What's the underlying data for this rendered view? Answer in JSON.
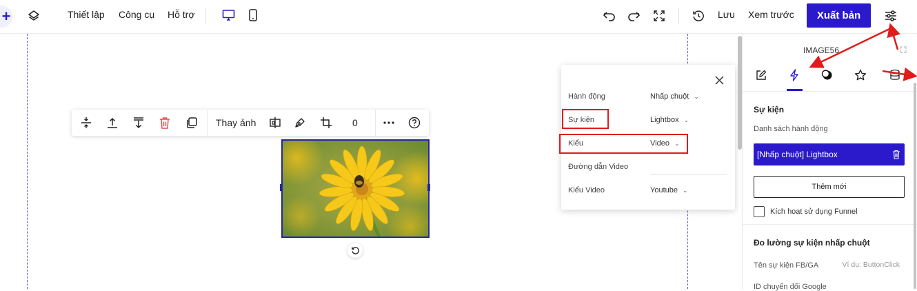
{
  "topbar": {
    "menu": [
      "Thiết lập",
      "Công cụ",
      "Hỗ trợ"
    ],
    "save_label": "Lưu",
    "preview_label": "Xem trước",
    "publish_label": "Xuất bản",
    "accent": "#2a1acb"
  },
  "toolbar": {
    "replace_image_label": "Thay ảnh",
    "rotation_value": "0"
  },
  "popup": {
    "rows": [
      {
        "label": "Hành động",
        "value": "Nhấp chuột"
      },
      {
        "label": "Sự kiện",
        "value": "Lightbox"
      },
      {
        "label": "Kiểu",
        "value": "Video"
      },
      {
        "label": "Đường dẫn Video",
        "value": ""
      },
      {
        "label": "Kiểu Video",
        "value": "Youtube"
      }
    ]
  },
  "panel": {
    "element_name": "IMAGE56",
    "tabs": [
      "edit-icon",
      "lightning-icon",
      "contrast-icon",
      "star-icon",
      "database-icon"
    ],
    "active_tab": 1,
    "event_section_title": "Sự kiện",
    "action_list_label": "Danh sách hành động",
    "action_item": "[Nhấp chuột] Lightbox",
    "add_new_label": "Thêm mới",
    "funnel_label": "Kích hoạt sử dụng Funnel",
    "tracking_title": "Đo lường sự kiện nhấp chuột",
    "fb_event_label": "Tên sự kiện FB/GA",
    "fb_event_placeholder": "Ví dụ: ButtonClick",
    "google_id_label": "ID chuyển đổi Google"
  },
  "colors": {
    "accent": "#2a1acb",
    "annotation_red": "#e01b1b",
    "delete_red": "#e04a4a"
  }
}
